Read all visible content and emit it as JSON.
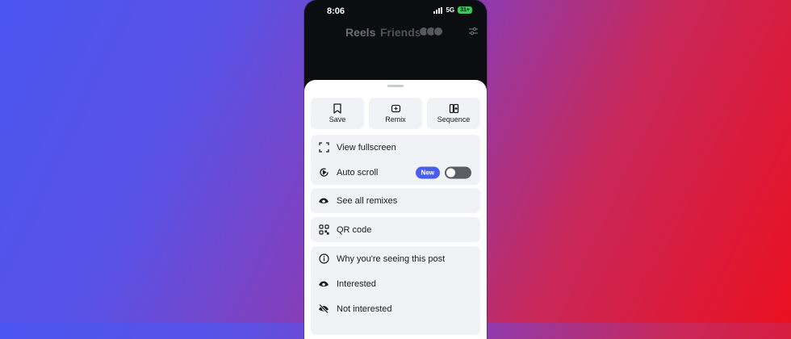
{
  "status_bar": {
    "time": "8:06",
    "network": "5G",
    "battery": "31+"
  },
  "top_nav": {
    "reels_label": "Reels",
    "friends_label": "Friends"
  },
  "sheet": {
    "actions": [
      {
        "label": "Save",
        "icon": "bookmark-icon"
      },
      {
        "label": "Remix",
        "icon": "remix-icon"
      },
      {
        "label": "Sequence",
        "icon": "sequence-icon"
      }
    ],
    "view_fullscreen": {
      "label": "View fullscreen",
      "icon": "fullscreen-icon"
    },
    "auto_scroll": {
      "label": "Auto scroll",
      "badge": "New",
      "toggle_on": false,
      "icon": "auto-scroll-icon"
    },
    "see_all_remixes": {
      "label": "See all remixes",
      "icon": "eye-icon"
    },
    "qr_code": {
      "label": "QR code",
      "icon": "qr-code-icon"
    },
    "why_seeing": {
      "label": "Why you're seeing this post",
      "icon": "info-icon"
    },
    "interested": {
      "label": "Interested",
      "icon": "eye-icon"
    },
    "not_interested": {
      "label": "Not interested",
      "icon": "eye-off-icon"
    }
  },
  "colors": {
    "accent": "#4a5df2",
    "sheet_bg": "#ffffff",
    "group_bg": "#f1f2f5",
    "toggle_off": "#5a5d63"
  }
}
